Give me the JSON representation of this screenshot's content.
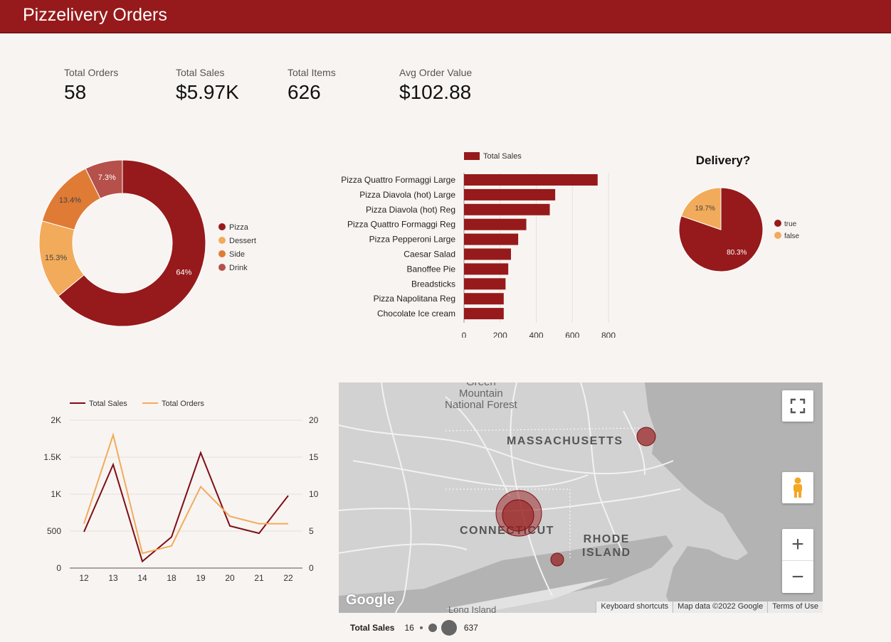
{
  "header": {
    "title": "Pizzelivery Orders"
  },
  "kpis": [
    {
      "label": "Total Orders",
      "value": "58"
    },
    {
      "label": "Total Sales",
      "value": "$5.97K"
    },
    {
      "label": "Total Items",
      "value": "626"
    },
    {
      "label": "Avg Order Value",
      "value": "$102.88"
    }
  ],
  "colors": {
    "brand": "#961a1b",
    "pizza": "#961a1b",
    "dessert": "#f2ab5a",
    "side": "#e07b35",
    "drink": "#b5504a",
    "orders_line": "#f2ab5a",
    "sales_line": "#7d0f14"
  },
  "chart_data": [
    {
      "type": "pie",
      "variant": "donut",
      "labels": [
        "Pizza",
        "Dessert",
        "Side",
        "Drink"
      ],
      "values": [
        64,
        15.3,
        13.4,
        7.3
      ],
      "value_labels": [
        "64%",
        "15.3%",
        "13.4%",
        "7.3%"
      ],
      "legend": "right"
    },
    {
      "type": "bar",
      "orientation": "horizontal",
      "categories": [
        "Pizza Quattro Formaggi Large",
        "Pizza Diavola (hot) Large",
        "Pizza Diavola (hot) Reg",
        "Pizza Quattro Formaggi Reg",
        "Pizza Pepperoni Large",
        "Caesar Salad",
        "Banoffee Pie",
        "Breadsticks",
        "Pizza Napolitana Reg",
        "Chocolate Ice cream"
      ],
      "series": [
        {
          "name": "Total Sales",
          "values": [
            740,
            505,
            475,
            345,
            300,
            260,
            245,
            230,
            220,
            220
          ]
        }
      ],
      "xlim": [
        0,
        800
      ],
      "xticks": [
        "0",
        "200",
        "400",
        "600",
        "800"
      ],
      "legend": "top"
    },
    {
      "type": "pie",
      "title": "Delivery?",
      "labels": [
        "true",
        "false"
      ],
      "values": [
        80.3,
        19.7
      ],
      "value_labels": [
        "80.3%",
        "19.7%"
      ],
      "legend": "right"
    },
    {
      "type": "line",
      "categories": [
        "12",
        "13",
        "14",
        "18",
        "19",
        "20",
        "21",
        "22"
      ],
      "series": [
        {
          "name": "Total Sales",
          "axis": "left",
          "values": [
            490,
            1400,
            90,
            420,
            1560,
            570,
            470,
            980
          ]
        },
        {
          "name": "Total Orders",
          "axis": "right",
          "values": [
            6,
            18,
            2,
            3,
            11,
            7,
            6,
            6
          ]
        }
      ],
      "ylim_left": [
        0,
        2000
      ],
      "yticks_left": [
        "0",
        "500",
        "1K",
        "1.5K",
        "2K"
      ],
      "ylim_right": [
        0,
        20
      ],
      "yticks_right": [
        "0",
        "5",
        "10",
        "15",
        "20"
      ],
      "grid": true,
      "legend": "top"
    }
  ],
  "map": {
    "labels": {
      "forest": [
        "Green",
        "Mountain",
        "National Forest"
      ],
      "ma": "MASSACHUSETTS",
      "ct": "CONNECTICUT",
      "ri": [
        "RHODE",
        "ISLAND"
      ],
      "li": "Long Island",
      "google": "Google"
    },
    "footer": {
      "shortcuts": "Keyboard shortcuts",
      "data": "Map data ©2022 Google",
      "terms": "Terms of Use"
    },
    "legend": {
      "label": "Total Sales",
      "min": "16",
      "max": "637"
    },
    "controls": {
      "fullscreen": "fullscreen-icon",
      "pegman": "pegman-icon",
      "zoom_in": "+",
      "zoom_out": "−"
    }
  }
}
